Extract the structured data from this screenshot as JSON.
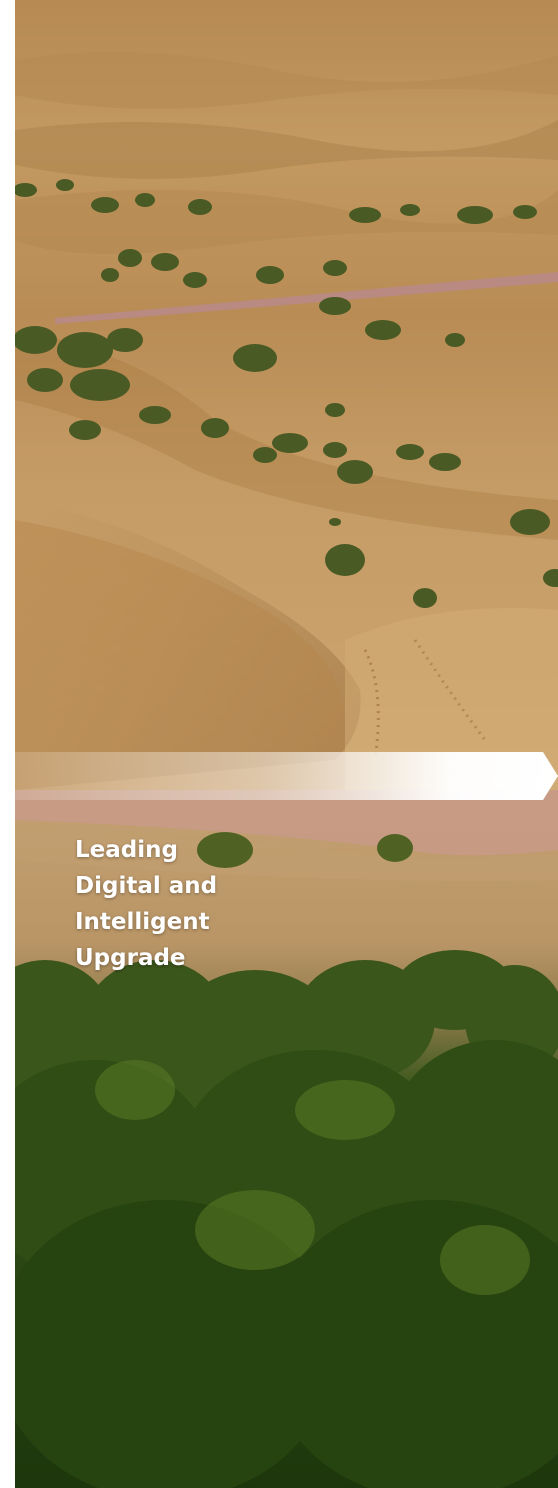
{
  "hero": {
    "headline_lines": [
      "Leading",
      "Digital and",
      "Intelligent",
      "Upgrade"
    ]
  },
  "colors": {
    "sand": "#c39a62",
    "shrub": "#4a5a24",
    "forest": "#2e4c16",
    "headline_text": "#ffffff"
  },
  "icons": {
    "arrow": "chevron-arrow-banner"
  }
}
